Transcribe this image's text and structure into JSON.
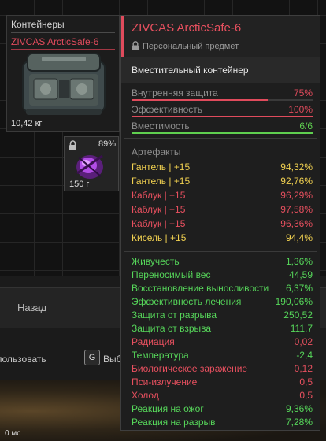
{
  "inventory": {
    "container_header": "Контейнеры",
    "container_name": "ZIVCAS ArcticSafe-6",
    "container_weight": "10,42 кг",
    "artifact_charge": "89%",
    "artifact_weight": "150 г"
  },
  "background": {
    "back_label": "Назад",
    "use_label": "пользовать",
    "key_hint": "G",
    "select_label": "Выб",
    "ping": "0 мс"
  },
  "tooltip": {
    "title": "ZIVCAS ArcticSafe-6",
    "personal": "Персональный предмет",
    "type": "Вместительный контейнер",
    "stats": [
      {
        "label": "Внутренняя защита",
        "value": "75%",
        "fill": 0.75,
        "color": "#e04b5c"
      },
      {
        "label": "Эффективность",
        "value": "100%",
        "fill": 1.0,
        "color": "#e04b5c"
      },
      {
        "label": "Вместимость",
        "value": "6/6",
        "fill": 1.0,
        "color": "#5fcf4f"
      }
    ],
    "artifacts_header": "Артефакты",
    "artifacts": [
      {
        "name": "Гантель | +15",
        "value": "94,32%",
        "color": "#f0d050"
      },
      {
        "name": "Гантель | +15",
        "value": "92,76%",
        "color": "#f0d050"
      },
      {
        "name": "Каблук | +15",
        "value": "96,29%",
        "color": "#e8505f"
      },
      {
        "name": "Каблук | +15",
        "value": "97,58%",
        "color": "#e8505f"
      },
      {
        "name": "Каблук | +15",
        "value": "96,36%",
        "color": "#e8505f"
      },
      {
        "name": "Кисель | +15",
        "value": "94,4%",
        "color": "#f0d050"
      }
    ],
    "properties": [
      {
        "name": "Живучесть",
        "value": "1,36%",
        "color": "#56d65a"
      },
      {
        "name": "Переносимый вес",
        "value": "44,59",
        "color": "#56d65a"
      },
      {
        "name": "Восстановление выносливости",
        "value": "6,37%",
        "color": "#56d65a"
      },
      {
        "name": "Эффективность лечения",
        "value": "190,06%",
        "color": "#56d65a"
      },
      {
        "name": "Защита от разрыва",
        "value": "250,52",
        "color": "#56d65a"
      },
      {
        "name": "Защита от взрыва",
        "value": "111,7",
        "color": "#56d65a"
      },
      {
        "name": "Радиация",
        "value": "0,02",
        "color": "#e8505f"
      },
      {
        "name": "Температура",
        "value": "-2,4",
        "color": "#56d65a"
      },
      {
        "name": "Биологическое заражение",
        "value": "0,12",
        "color": "#e8505f"
      },
      {
        "name": "Пси-излучение",
        "value": "0,5",
        "color": "#e8505f"
      },
      {
        "name": "Холод",
        "value": "0,5",
        "color": "#e8505f"
      },
      {
        "name": "Реакция на ожог",
        "value": "9,36%",
        "color": "#56d65a"
      },
      {
        "name": "Реакция на разрыв",
        "value": "7,28%",
        "color": "#56d65a"
      }
    ]
  }
}
